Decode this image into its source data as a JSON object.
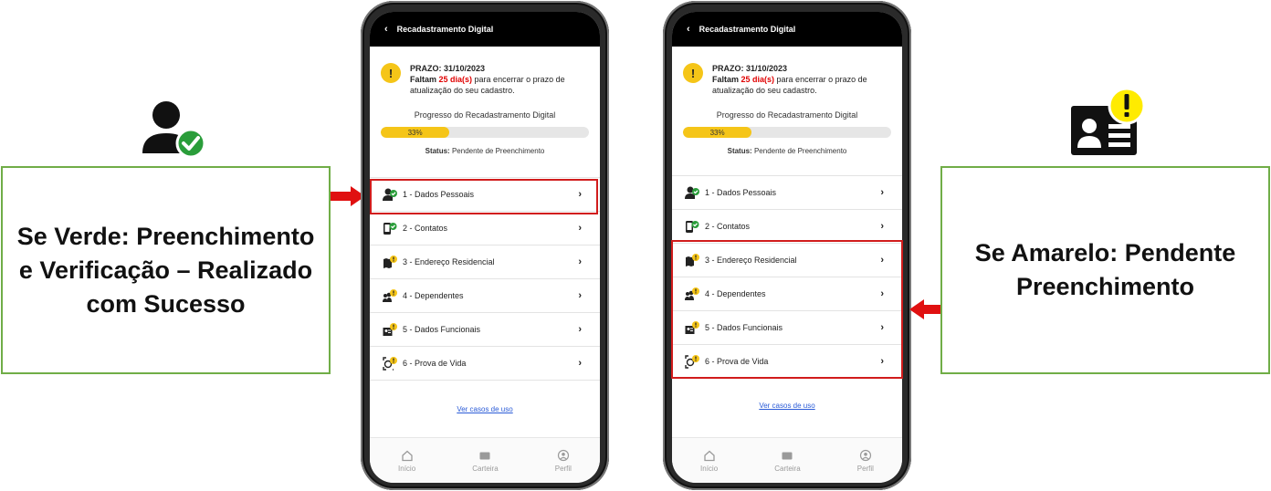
{
  "callouts": {
    "left": "Se Verde: Preenchimento e Verificação – Realizado com Sucesso",
    "right": "Se Amarelo: Pendente Preenchimento"
  },
  "icons": {
    "left_big": "user-check-icon",
    "right_big": "id-card-alert-icon",
    "arrow": "arrow-icon"
  },
  "colors": {
    "green": "#2a9d3a",
    "yellow": "#f5c518",
    "highlight_red": "#d11c1c",
    "arrow_red": "#e01010",
    "callout_border": "#70ad47"
  },
  "app": {
    "title": "Recadastramento Digital",
    "notice": {
      "deadline": "PRAZO: 31/10/2023",
      "faltam": "Faltam",
      "days": "25 dia(s)",
      "rest": " para encerrar o prazo de atualização do seu cadastro."
    },
    "progress": {
      "title": "Progresso do Recadastramento Digital",
      "percent": 33,
      "percent_label": "33%"
    },
    "status": {
      "label": "Status:",
      "value": "Pendente de Preenchimento"
    },
    "menu": [
      {
        "label": "1 - Dados Pessoais",
        "icon": "user-check-icon"
      },
      {
        "label": "2 - Contatos",
        "icon": "phone-check-icon"
      },
      {
        "label": "3 - Endereço Residencial",
        "icon": "map-alert-icon"
      },
      {
        "label": "4 - Dependentes",
        "icon": "group-alert-icon"
      },
      {
        "label": "5 - Dados Funcionais",
        "icon": "badge-alert-icon"
      },
      {
        "label": "6 - Prova de Vida",
        "icon": "face-scan-alert-icon"
      }
    ],
    "link": "Ver casos de uso",
    "nav": [
      {
        "label": "Início",
        "icon": "home-icon"
      },
      {
        "label": "Carteira",
        "icon": "wallet-icon"
      },
      {
        "label": "Perfil",
        "icon": "profile-icon"
      }
    ]
  }
}
